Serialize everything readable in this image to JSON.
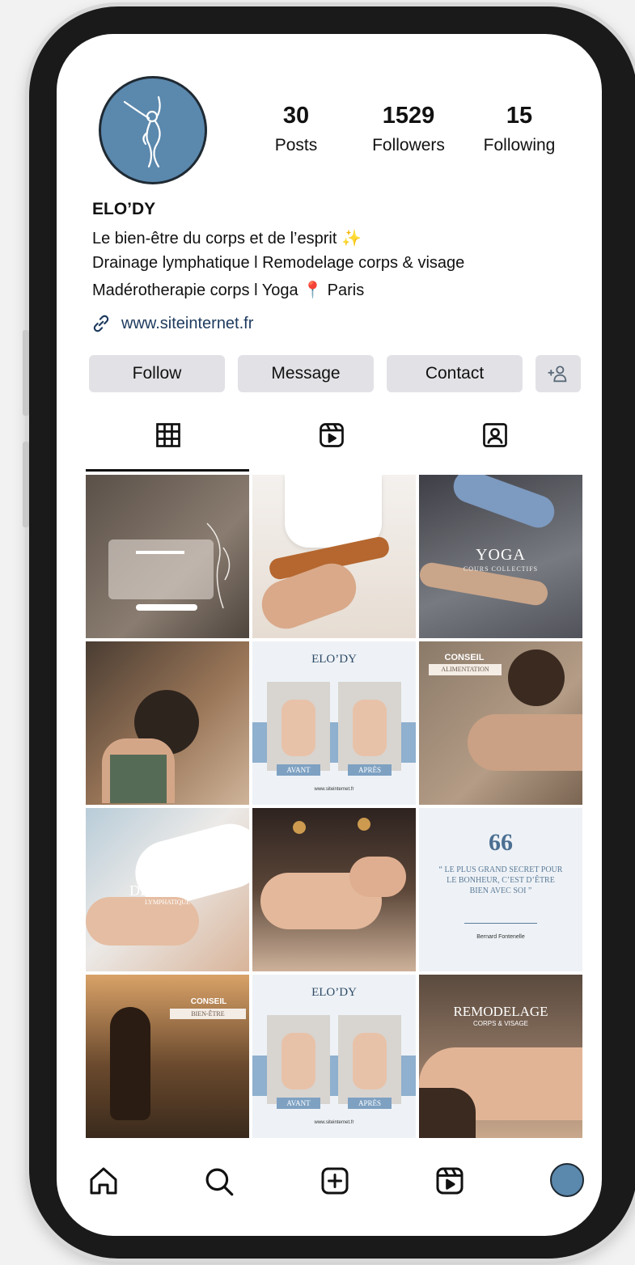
{
  "profile": {
    "stats": [
      {
        "value": "30",
        "label": "Posts"
      },
      {
        "value": "1529",
        "label": "Followers"
      },
      {
        "value": "15",
        "label": "Following"
      }
    ],
    "name": "ELO’DY",
    "bio": [
      "Le bien-être du corps et de l’esprit ✨",
      "Drainage lymphatique l Remodelage corps & visage",
      "Madérotherapie corps l Yoga 📍 Paris"
    ],
    "website": "www.siteinternet.fr"
  },
  "actions": {
    "follow": "Follow",
    "message": "Message",
    "contact": "Contact"
  },
  "tabs": [
    "grid-tab",
    "reels-tab",
    "tagged-tab"
  ],
  "posts": [
    {
      "theme": "review",
      "title": "",
      "subtitle": ""
    },
    {
      "theme": "massage-roller",
      "title": "",
      "subtitle": ""
    },
    {
      "theme": "yoga",
      "title": "YOGA",
      "subtitle": "COURS COLLECTIFS"
    },
    {
      "theme": "yoga-back",
      "title": "",
      "subtitle": ""
    },
    {
      "theme": "before-after",
      "title": "ELO’DY",
      "before": "AVANT",
      "after": "APRÈS",
      "footer": "www.siteinternet.fr"
    },
    {
      "theme": "conseil",
      "title": "CONSEIL",
      "subtitle": "ALIMENTATION"
    },
    {
      "theme": "drainage",
      "title": "DRAINAGE",
      "subtitle": "LYMPHATIQUE"
    },
    {
      "theme": "facial",
      "title": "",
      "subtitle": ""
    },
    {
      "theme": "quote",
      "quote_mark": "66",
      "quote": "“ LE PLUS GRAND SECRET POUR LE BONHEUR, C’EST D’ÊTRE BIEN AVEC SOI ”",
      "author": "Bernard Fontenelle"
    },
    {
      "theme": "conseil-bienetre",
      "title": "CONSEIL",
      "subtitle": "BIEN-ÊTRE"
    },
    {
      "theme": "before-after",
      "title": "ELO’DY",
      "before": "AVANT",
      "after": "APRÈS",
      "footer": "www.siteinternet.fr"
    },
    {
      "theme": "remodelage",
      "title": "REMODELAGE",
      "subtitle": "CORPS & VISAGE"
    }
  ],
  "nav": [
    "home-icon",
    "search-icon",
    "new-post-icon",
    "reels-icon",
    "profile-avatar"
  ],
  "colors": {
    "accent": "#5b88ad",
    "button_bg": "#e2e2e6",
    "link": "#1d3a5e"
  }
}
